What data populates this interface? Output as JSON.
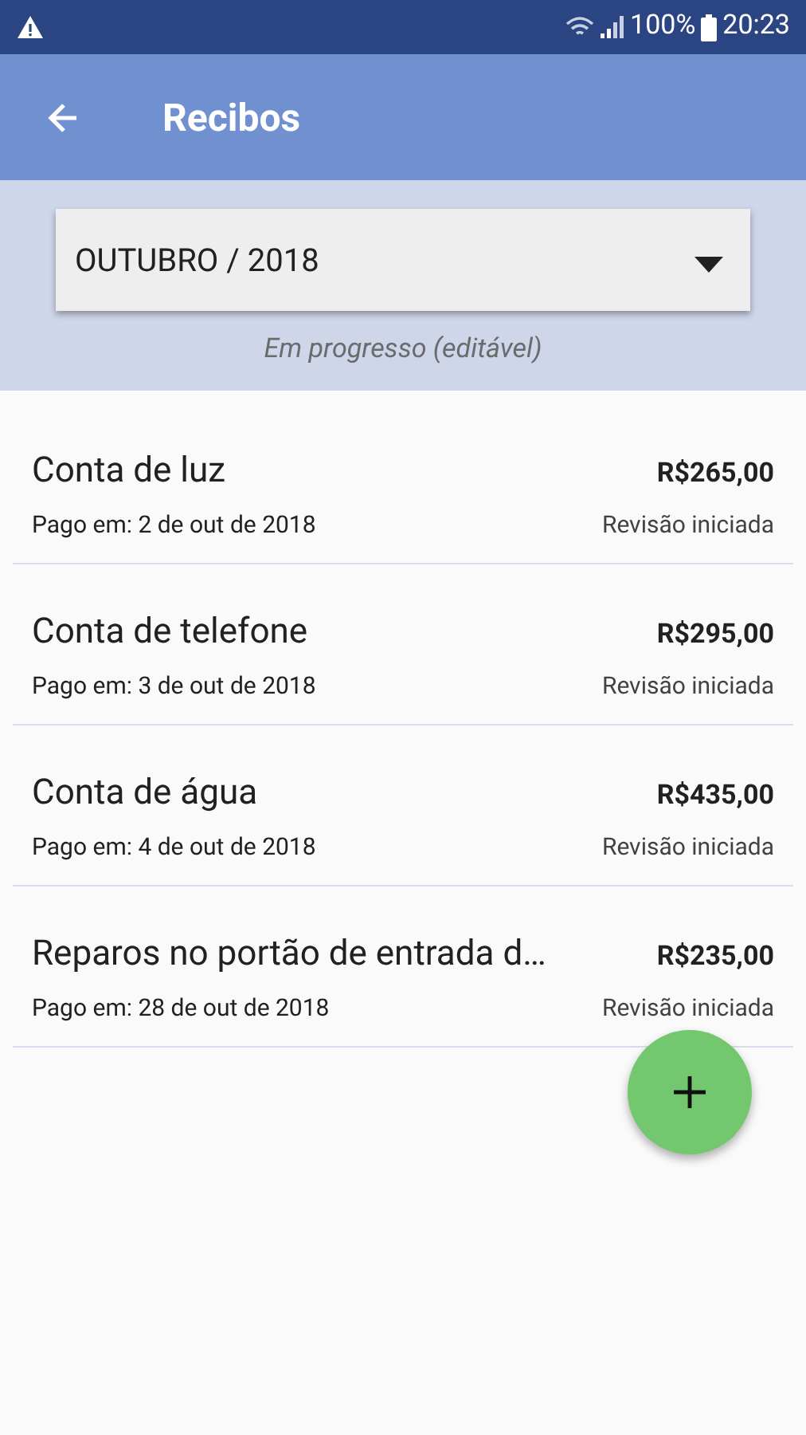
{
  "status_bar": {
    "battery": "100%",
    "time": "20:23"
  },
  "app_bar": {
    "title": "Recibos"
  },
  "period": {
    "value": "OUTUBRO / 2018",
    "status": "Em progresso (editável)"
  },
  "receipts": [
    {
      "title": "Conta de luz",
      "amount": "R$265,00",
      "paid": "Pago em: 2 de out de 2018",
      "status": "Revisão iniciada"
    },
    {
      "title": "Conta de telefone",
      "amount": "R$295,00",
      "paid": "Pago em: 3 de out de 2018",
      "status": "Revisão iniciada"
    },
    {
      "title": "Conta de água",
      "amount": "R$435,00",
      "paid": "Pago em: 4 de out de 2018",
      "status": "Revisão iniciada"
    },
    {
      "title": "Reparos no portão de entrada d…",
      "amount": "R$235,00",
      "paid": "Pago em: 28 de out de 2018",
      "status": "Revisão iniciada"
    }
  ]
}
